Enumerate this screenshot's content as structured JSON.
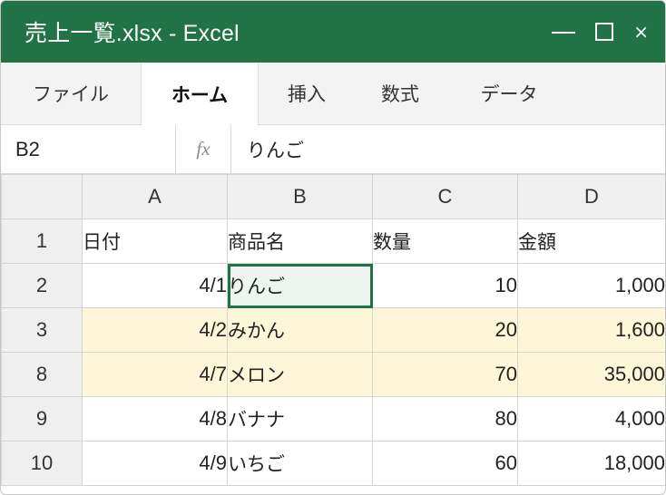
{
  "window": {
    "title": "売上一覧.xlsx - Excel",
    "accent_color": "#217346",
    "controls": {
      "minimize_icon": "minimize-icon",
      "maximize_icon": "maximize-icon",
      "close_glyph": "×"
    }
  },
  "ribbon": {
    "tabs": [
      {
        "label": "ファイル",
        "active": false
      },
      {
        "label": "ホーム",
        "active": true
      },
      {
        "label": "挿入",
        "active": false
      },
      {
        "label": "数式",
        "active": false
      },
      {
        "label": "データ",
        "active": false
      }
    ]
  },
  "formula_bar": {
    "name_box": "B2",
    "fx_label": "fx",
    "content": "りんご"
  },
  "sheet": {
    "columns": [
      "A",
      "B",
      "C",
      "D"
    ],
    "rows": [
      {
        "num": "1",
        "cells": [
          "日付",
          "商品名",
          "数量",
          "金額"
        ],
        "header": true,
        "highlight": false
      },
      {
        "num": "2",
        "cells": [
          "4/1",
          "りんご",
          "10",
          "1,000"
        ],
        "header": false,
        "highlight": false,
        "selected_col": 1
      },
      {
        "num": "3",
        "cells": [
          "4/2",
          "みかん",
          "20",
          "1,600"
        ],
        "header": false,
        "highlight": true
      },
      {
        "num": "8",
        "cells": [
          "4/7",
          "メロン",
          "70",
          "35,000"
        ],
        "header": false,
        "highlight": true
      },
      {
        "num": "9",
        "cells": [
          "4/8",
          "バナナ",
          "80",
          "4,000"
        ],
        "header": false,
        "highlight": false
      },
      {
        "num": "10",
        "cells": [
          "4/9",
          "いちご",
          "60",
          "18,000"
        ],
        "header": false,
        "highlight": false
      }
    ],
    "highlight_color": "#fdf6d8"
  }
}
